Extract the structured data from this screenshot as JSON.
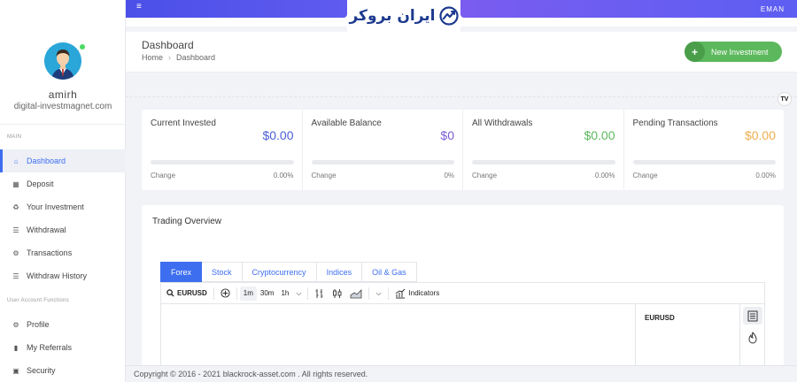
{
  "user": {
    "name": "amirh",
    "site": "digital-investmagnet.com"
  },
  "sidebar": {
    "main_label": "MAIN",
    "items": [
      {
        "label": "Dashboard",
        "icon": "home-icon"
      },
      {
        "label": "Deposit",
        "icon": "grid-icon"
      },
      {
        "label": "Your Investment",
        "icon": "recycle-icon"
      },
      {
        "label": "Withdrawal",
        "icon": "list-icon"
      },
      {
        "label": "Transactions",
        "icon": "cog-icon"
      },
      {
        "label": "Withdraw History",
        "icon": "history-icon"
      }
    ],
    "account_label": "User Account Functions",
    "account_items": [
      {
        "label": "Profile",
        "icon": "user-cog-icon"
      },
      {
        "label": "My Referrals",
        "icon": "thumbs-up-icon"
      },
      {
        "label": "Security",
        "icon": "lock-icon"
      }
    ]
  },
  "topbar": {
    "user": "EMAN",
    "logo_text": "ایران بروکر"
  },
  "header": {
    "title": "Dashboard",
    "breadcrumb": [
      "Home",
      "Dashboard"
    ],
    "new_investment_label": "New Investment"
  },
  "stats": [
    {
      "label": "Current Invested",
      "value": "$0.00",
      "color": "#4b5fd6",
      "change_label": "Change",
      "change": "0.00%"
    },
    {
      "label": "Available Balance",
      "value": "$0",
      "color": "#7b5cd8",
      "change_label": "Change",
      "change": "0%"
    },
    {
      "label": "All Withdrawals",
      "value": "$0.00",
      "color": "#5cb85c",
      "change_label": "Change",
      "change": "0.00%"
    },
    {
      "label": "Pending Transactions",
      "value": "$0.00",
      "color": "#f0ad4e",
      "change_label": "Change",
      "change": "0.00%"
    }
  ],
  "trading": {
    "title": "Trading Overview",
    "tabs": [
      "Forex",
      "Stock",
      "Cryptocurrency",
      "Indices",
      "Oil & Gas"
    ],
    "active_tab": "Forex",
    "symbol": "EURUSD",
    "intervals": [
      "1m",
      "30m",
      "1h"
    ],
    "selected_interval": "1m",
    "indicators_label": "Indicators",
    "side_symbol": "EURUSD",
    "tv_badge": "TV"
  },
  "footer": {
    "text": "Copyright © 2016 - 2021 blackrock-asset.com . All rights reserved."
  }
}
